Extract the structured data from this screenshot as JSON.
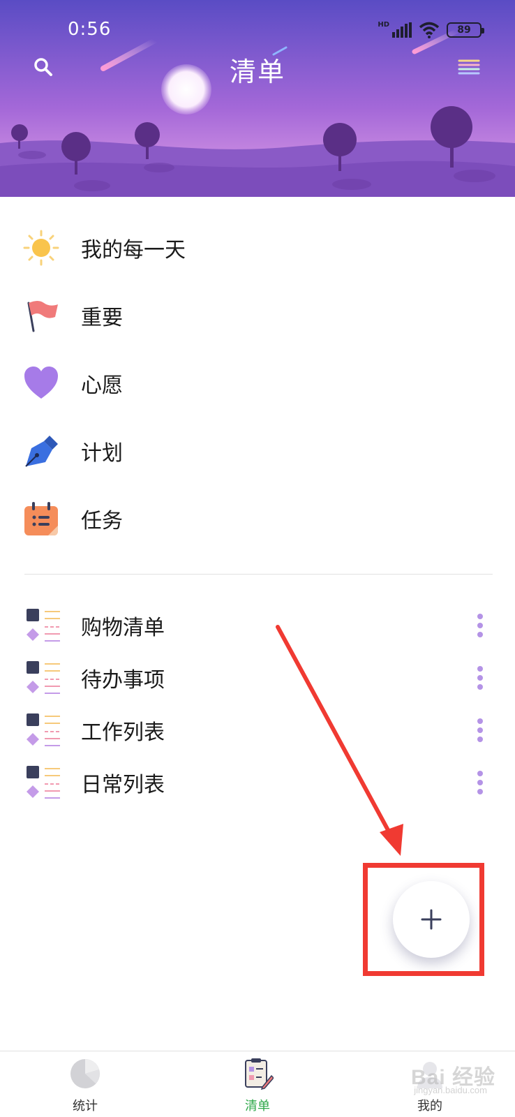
{
  "status_bar": {
    "time": "0:56",
    "network_label": "HD",
    "battery": "89"
  },
  "header": {
    "title": "清单",
    "search_icon": "search-icon",
    "menu_icon": "menu-icon"
  },
  "smart_lists": [
    {
      "label": "我的每一天",
      "icon": "sun-icon"
    },
    {
      "label": "重要",
      "icon": "flag-icon"
    },
    {
      "label": "心愿",
      "icon": "heart-icon"
    },
    {
      "label": "计划",
      "icon": "pen-icon"
    },
    {
      "label": "任务",
      "icon": "calendar-icon"
    }
  ],
  "custom_lists": [
    {
      "label": "购物清单",
      "icon": "list-icon"
    },
    {
      "label": "待办事项",
      "icon": "list-icon"
    },
    {
      "label": "工作列表",
      "icon": "list-icon"
    },
    {
      "label": "日常列表",
      "icon": "list-icon"
    }
  ],
  "fab": {
    "icon": "plus-icon"
  },
  "bottom_nav": [
    {
      "label": "统计",
      "icon": "pie-chart-icon",
      "active": false
    },
    {
      "label": "清单",
      "icon": "checklist-icon",
      "active": true
    },
    {
      "label": "我的",
      "icon": "profile-icon",
      "active": false
    }
  ],
  "watermark": {
    "text": "Bai 经验",
    "sub": "jingyan.baidu.com"
  },
  "colors": {
    "accent_active": "#2ea84a",
    "header_top": "#5a4cc4",
    "header_bottom": "#c07de0",
    "highlight": "#f03a32",
    "more_dots": "#b493e6"
  }
}
